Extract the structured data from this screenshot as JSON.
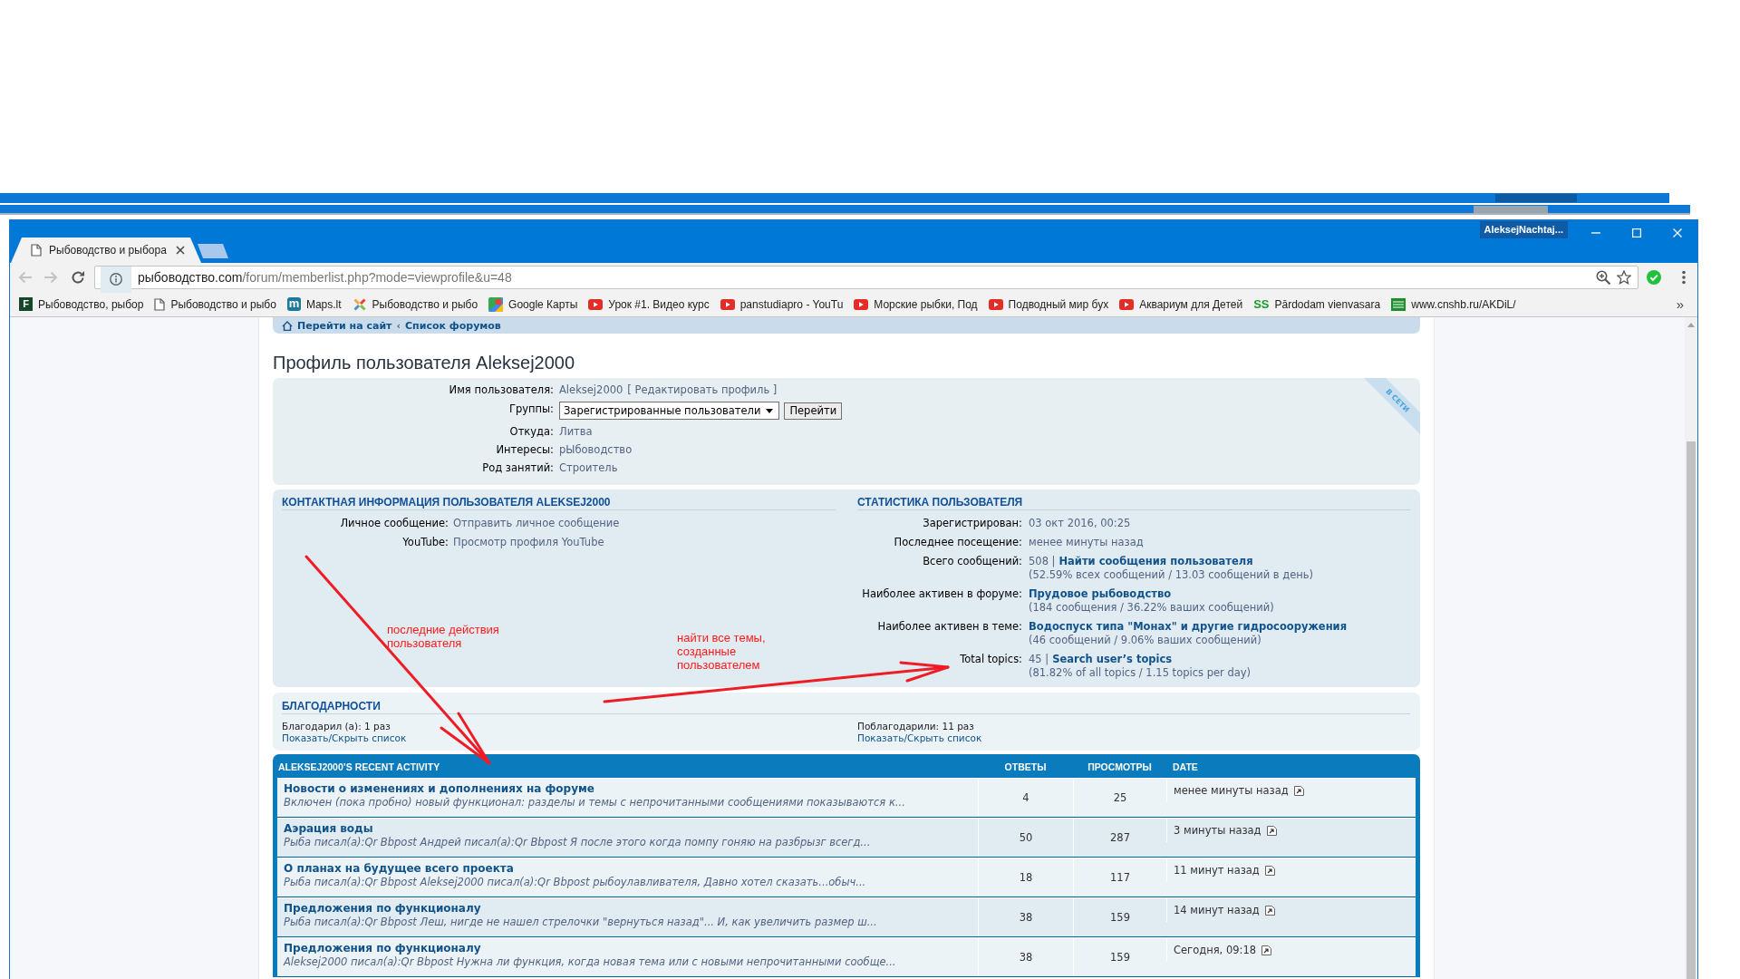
{
  "browser": {
    "tabs": [
      {
        "title": "Рыбоводство и рыбора",
        "selected": true
      }
    ],
    "profile_name": "AleksejNachtaj...",
    "back": {
      "disabled": true
    },
    "forward": {
      "disabled": true
    },
    "address": {
      "host": "рыбоводство.com",
      "path": "/forum/memberlist.php?mode=viewprofile&u=48"
    },
    "bookmarks": [
      {
        "label": "Рыбоводство, рыбор",
        "kind": "forum",
        "icon_text": "F"
      },
      {
        "label": "Рыбоводство и рыбо",
        "kind": "page"
      },
      {
        "label": "Maps.lt",
        "kind": "maps",
        "icon_text": "m"
      },
      {
        "label": "Рыбоводство и рыбо",
        "kind": "joomla"
      },
      {
        "label": "Google Карты",
        "kind": "gmaps"
      },
      {
        "label": "Урок #1. Видео курс",
        "kind": "youtube"
      },
      {
        "label": "panstudiapro - YouTu",
        "kind": "youtube"
      },
      {
        "label": "Морские рыбки, Под",
        "kind": "youtube"
      },
      {
        "label": "Подводный мир бух",
        "kind": "youtube"
      },
      {
        "label": "Аквариум для Детей",
        "kind": "youtube"
      },
      {
        "label": "Pārdodam vienvasara",
        "kind": "ss",
        "icon_text": "SS"
      },
      {
        "label": "www.cnshb.ru/AKDiL/",
        "kind": "cnshb"
      }
    ],
    "bookmarks_more": "»"
  },
  "page": {
    "breadcrumbs": [
      {
        "label": "Перейти на сайт"
      },
      {
        "label": "Список форумов"
      }
    ],
    "breadcrumb_separator": "‹"
  },
  "profile": {
    "title": "Профиль пользователя Aleksej2000",
    "online_label": "В СЕТИ",
    "fields": [
      {
        "kind": "text",
        "label": "Имя пользователя:",
        "value": "Aleksej2000",
        "link": "[ Редактировать профиль ]"
      },
      {
        "kind": "select",
        "label": "Группы:",
        "value": "Зарегистрированные пользователи",
        "button": "Перейти"
      },
      {
        "kind": "text",
        "label": "Откуда:",
        "value": "Литва"
      },
      {
        "kind": "text",
        "label": "Интересы:",
        "value": "рЫбоводство"
      },
      {
        "kind": "text",
        "label": "Род занятий:",
        "value": "Строитель"
      }
    ]
  },
  "contact": {
    "title": "КОНТАКТНАЯ ИНФОРМАЦИЯ ПОЛЬЗОВАТЕЛЯ ALEKSEJ2000",
    "fields": [
      {
        "label": "Личное сообщение:",
        "link": "Отправить личное сообщение"
      },
      {
        "label": "YouTube:",
        "link": "Просмотр профиля YouTube"
      }
    ]
  },
  "statistics": {
    "title": "СТАТИСТИКА ПОЛЬЗОВАТЕЛЯ",
    "fields": [
      {
        "label": "Зарегистрирован:",
        "value": "03 окт 2016, 00:25"
      },
      {
        "label": "Последнее посещение:",
        "value": "менее минуты назад"
      },
      {
        "label": "Всего сообщений:",
        "value": "508 |",
        "link": "Найти сообщения пользователя",
        "detail": "(52.59% всех сообщений / 13.03 сообщений в день)"
      },
      {
        "label": "Наиболее активен в форуме:",
        "link": "Прудовое рыбоводство",
        "detail": "(184 сообщения / 36.22% ваших сообщений)"
      },
      {
        "label": "Наиболее активен в теме:",
        "link": "Водоспуск типа \"Монах\" и другие гидросооружения",
        "detail": "(46 сообщений / 9.06% ваших сообщений)"
      },
      {
        "label": "Total topics:",
        "value": "45 |",
        "link": "Search user’s topics",
        "detail": "(81.82% of all topics / 1.15 topics per day)"
      }
    ]
  },
  "thanks": {
    "title": "БЛАГОДАРНОСТИ",
    "columns": [
      {
        "text": "Благодарил (а): 1 раз",
        "toggle": "Показать/Скрыть список"
      },
      {
        "text": "Поблагодарили: 11 раз",
        "toggle": "Показать/Скрыть список"
      }
    ]
  },
  "recent_activity": {
    "title": "ALEKSEJ2000’S RECENT ACTIVITY",
    "columns": [
      "ОТВЕТЫ",
      "ПРОСМОТРЫ",
      "DATE"
    ],
    "rows": [
      {
        "topic": "Новости о изменениях и дополнениях на форуме",
        "excerpt": "Включен (пока пробно) новый функционал: разделы и темы с непрочитанными сообщениями показываются к...",
        "replies": "4",
        "views": "25",
        "date": "менее минуты назад"
      },
      {
        "topic": "Аэрация воды",
        "excerpt": "Рыба писал(а):Qr Bbpost Андрей писал(а):Qr Bbpost Я после этого когда помпу гоняю на разбрызг всегд...",
        "replies": "50",
        "views": "287",
        "date": "3 минуты назад"
      },
      {
        "topic": "О планах на будущее всего проекта",
        "excerpt": "Рыба писал(а):Qr Bbpost Aleksej2000 писал(а):Qr Bbpost рыбоулавливателя, Давно хотел сказать...обыч...",
        "replies": "18",
        "views": "117",
        "date": "11 минут назад"
      },
      {
        "topic": "Предложения по функционалу",
        "excerpt": "Рыба писал(а):Qr Bbpost Леш, нигде не нашел стрелочки \"вернуться назад\"... И, как увеличить размер ш...",
        "replies": "38",
        "views": "159",
        "date": "14 минут назад"
      },
      {
        "topic": "Предложения по функционалу",
        "excerpt": "Aleksej2000 писал(а):Qr Bbpost Нужна ли функция, когда новая тема или с новыми непрочитанными сообще...",
        "replies": "38",
        "views": "159",
        "date": "Сегодня, 09:18"
      }
    ]
  },
  "annotations": {
    "notes": [
      "последние действия пользователя",
      "найти все темы, созданные пользователем"
    ]
  }
}
